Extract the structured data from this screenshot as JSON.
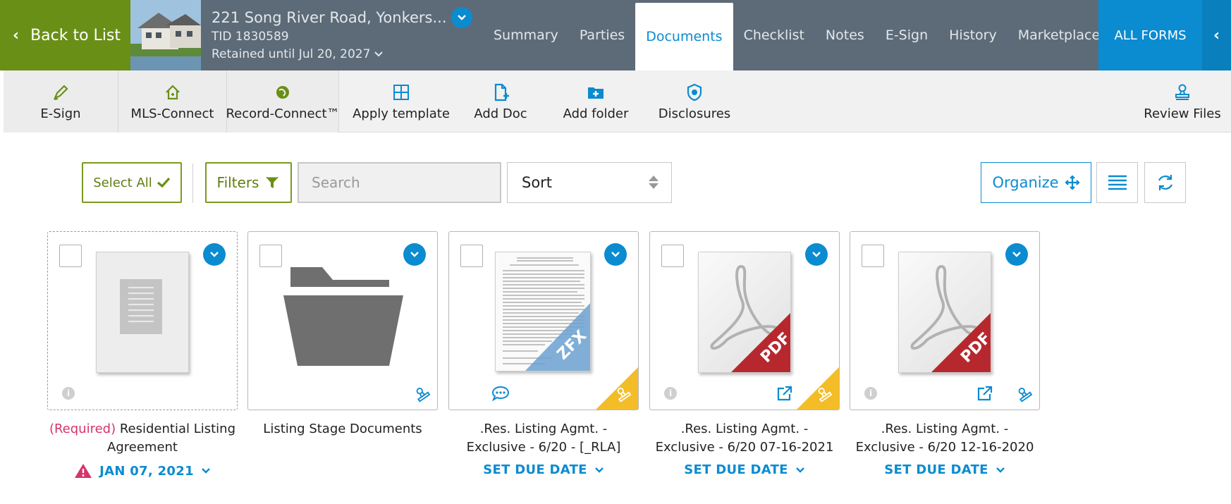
{
  "header": {
    "back_label": "Back to List",
    "address": "221 Song River Road, Yonkers...",
    "tid": "TID 1830589",
    "retained": "Retained until Jul 20, 2027",
    "all_forms": "ALL FORMS",
    "tabs": [
      "Summary",
      "Parties",
      "Documents",
      "Checklist",
      "Notes",
      "E-Sign",
      "History",
      "Marketplace"
    ],
    "active_tab": "Documents"
  },
  "toolbar": {
    "esign": "E-Sign",
    "mls_connect": "MLS-Connect",
    "record_connect": "Record-Connect™",
    "apply_template": "Apply template",
    "add_doc": "Add Doc",
    "add_folder": "Add folder",
    "disclosures": "Disclosures",
    "review_files": "Review Files"
  },
  "controls": {
    "select_all": "Select All",
    "filters": "Filters",
    "search_placeholder": "Search",
    "sort": "Sort",
    "organize": "Organize"
  },
  "documents": [
    {
      "required_tag": "(Required)",
      "title": " Residential Listing Agreement",
      "due": "JAN 07, 2021"
    },
    {
      "title": "Listing Stage Documents"
    },
    {
      "title_line1": ".Res. Listing Agmt. -",
      "title_line2": "Exclusive - 6/20 - [_RLA]",
      "due": "SET DUE DATE",
      "badge": "ZFX"
    },
    {
      "title_line1": ".Res. Listing Agmt. -",
      "title_line2": "Exclusive - 6/20 07-16-2021",
      "due": "SET DUE DATE",
      "badge": "PDF"
    },
    {
      "title_line1": ".Res. Listing Agmt. -",
      "title_line2": "Exclusive - 6/20 12-16-2020",
      "due": "SET DUE DATE",
      "badge": "PDF"
    }
  ],
  "colors": {
    "header_bg": "#5d6b78",
    "back_green": "#6a8f17",
    "accent_blue": "#0b8bd0",
    "corner_yellow": "#f3bd27",
    "required_pink": "#d6336c"
  }
}
